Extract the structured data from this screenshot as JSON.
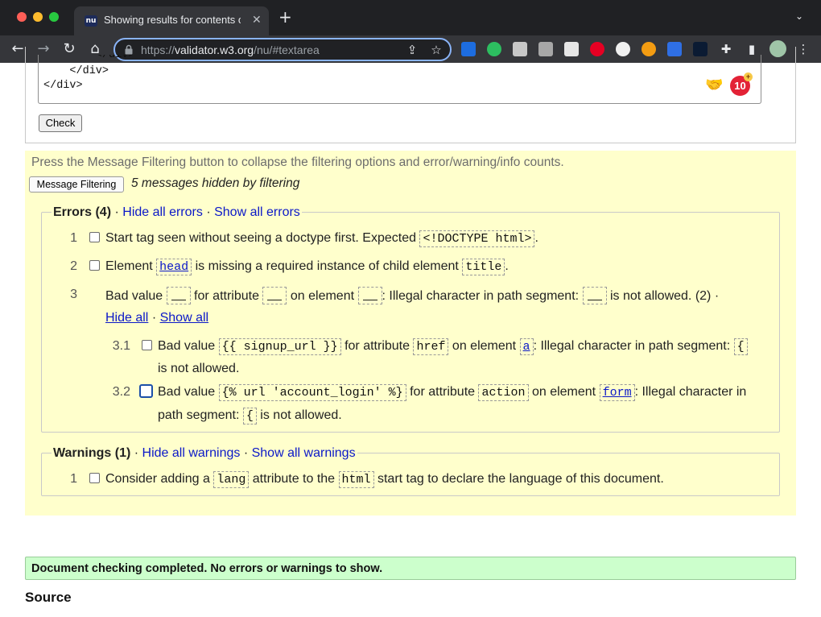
{
  "browser": {
    "tab_title": "Showing results for contents of text-input area",
    "tab_favicon_text": "nu",
    "url_prefix": "https://",
    "url_host": "validator.w3.org",
    "url_path": "/nu/#textarea"
  },
  "editor": {
    "lines": [
      "        </div>",
      "    </div>",
      "</div>"
    ],
    "notification_count": "10",
    "notification_plus": "+",
    "check_label": "Check"
  },
  "filtering": {
    "info": "Press the Message Filtering button to collapse the filtering options and error/warning/info counts.",
    "button_label": "Message Filtering",
    "hidden_count": "5 messages hidden by filtering"
  },
  "errors": {
    "heading": "Errors (4)",
    "sep": "·",
    "hide_all": "Hide all errors",
    "show_all": "Show all errors",
    "items": [
      {
        "num": "1",
        "text_a": "Start tag seen without seeing a doctype first. Expected ",
        "code_a": "<!DOCTYPE html>",
        "text_b": "."
      },
      {
        "num": "2",
        "text_a": "Element ",
        "code_a": "head",
        "text_b": " is missing a required instance of child element ",
        "code_b": "title",
        "text_c": "."
      },
      {
        "num": "3",
        "t1": "Bad value ",
        "t2": " for attribute ",
        "t3": " on element ",
        "t4": ": Illegal character in path segment: ",
        "t5": " is not allowed. (2) ·",
        "hide_all": "Hide all",
        "show_all": "Show all",
        "sub": [
          {
            "num": "3.1",
            "t1": "Bad value ",
            "c1": "{{ signup_url }}",
            "t2": " for attribute ",
            "c2": "href",
            "t3": " on element ",
            "c3": "a",
            "t4": ": Illegal character in path segment: ",
            "c4": "{",
            "t5": "is not allowed."
          },
          {
            "num": "3.2",
            "t1": "Bad value ",
            "c1": "{% url 'account_login' %}",
            "t2": " for attribute ",
            "c2": "action",
            "t3": " on element ",
            "c3": "form",
            "t4": ": Illegal character in",
            "t5": "path segment: ",
            "c4": "{",
            "t6": " is not allowed."
          }
        ]
      }
    ]
  },
  "warnings": {
    "heading": "Warnings (1)",
    "sep": "·",
    "hide_all": "Hide all warnings",
    "show_all": "Show all warnings",
    "items": [
      {
        "num": "1",
        "text_a": "Consider adding a ",
        "code_a": "lang",
        "text_b": " attribute to the ",
        "code_b": "html",
        "text_c": " start tag to declare the language of this document."
      }
    ]
  },
  "result": {
    "success": "Document checking completed. No errors or warnings to show.",
    "source_heading": "Source"
  },
  "colors": {
    "filter_bg": "#ffffcc",
    "success_bg": "#ccffcc",
    "link": "#0b18c8",
    "omnibox_focus": "#8ab4f8"
  },
  "icons": [
    "back-icon",
    "forward-icon",
    "reload-icon",
    "home-icon",
    "lock-icon",
    "share-icon",
    "star-icon",
    "extensions-icon",
    "sidepanel-icon",
    "profile-avatar",
    "menu-icon"
  ]
}
